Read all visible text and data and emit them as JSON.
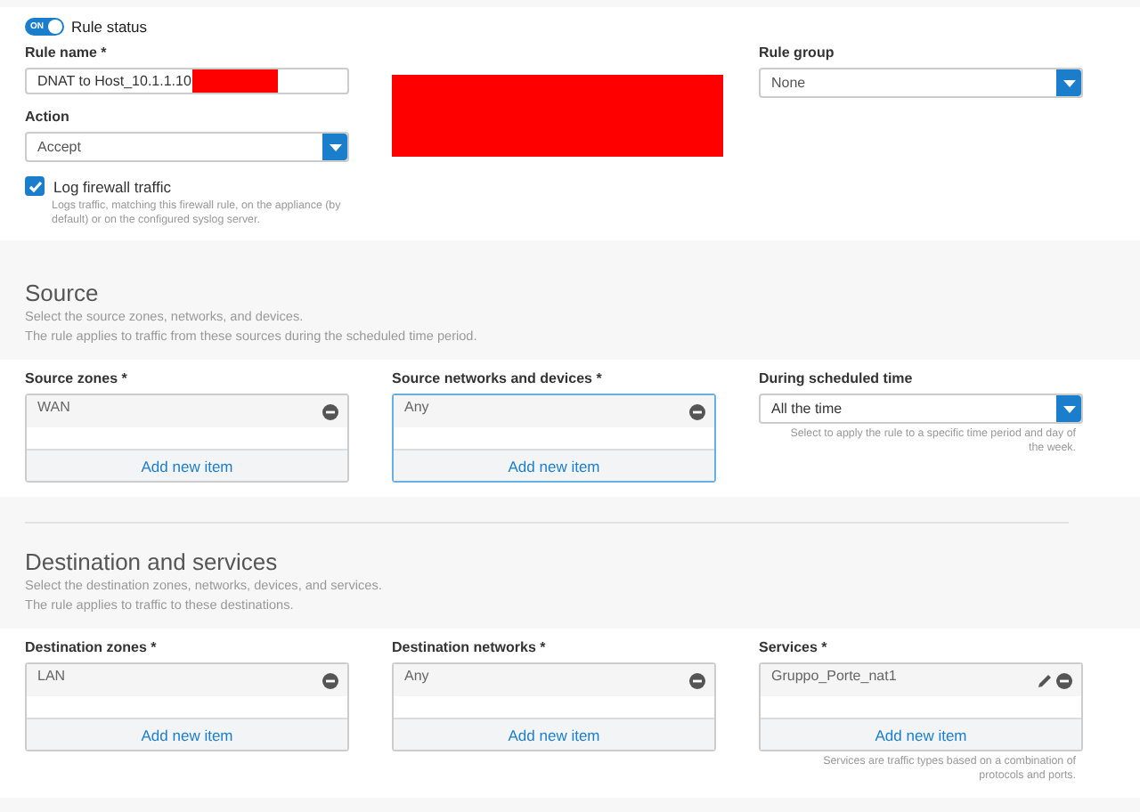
{
  "rule_status": {
    "label": "Rule status",
    "toggle_text": "ON",
    "on": true
  },
  "rule_name": {
    "label": "Rule name *",
    "value": "DNAT to Host_10.1.1.10",
    "redacted": true
  },
  "description": {
    "redacted": true
  },
  "rule_group": {
    "label": "Rule group",
    "value": "None"
  },
  "action": {
    "label": "Action",
    "value": "Accept"
  },
  "log_traffic": {
    "label": "Log firewall traffic",
    "checked": true,
    "help": "Logs traffic, matching this firewall rule, on the appliance (by default) or on the configured syslog server."
  },
  "sections": [
    {
      "title": "Source",
      "description": [
        "Select the source zones, networks, and devices.",
        "The rule applies to traffic from these sources during the scheduled time period."
      ],
      "fields": [
        {
          "kind": "list",
          "label": "Source zones *",
          "focused": false,
          "items": [
            {
              "text": "WAN",
              "editable": false
            }
          ],
          "add": "Add new item"
        },
        {
          "kind": "list",
          "label": "Source networks and devices *",
          "focused": true,
          "items": [
            {
              "text": "Any",
              "editable": false
            }
          ],
          "add": "Add new item"
        },
        {
          "kind": "select",
          "label": "During scheduled time",
          "value": "All the time",
          "help": "Select to apply the rule to a specific time period and day of the week."
        }
      ]
    },
    {
      "title": "Destination and services",
      "description": [
        "Select the destination zones, networks, devices, and services.",
        "The rule applies to traffic to these destinations."
      ],
      "fields": [
        {
          "kind": "list",
          "label": "Destination zones *",
          "focused": false,
          "items": [
            {
              "text": "LAN",
              "editable": false
            }
          ],
          "add": "Add new item"
        },
        {
          "kind": "list",
          "label": "Destination networks *",
          "focused": false,
          "items": [
            {
              "text": "Any",
              "editable": false
            }
          ],
          "add": "Add new item"
        },
        {
          "kind": "list",
          "label": "Services *",
          "focused": false,
          "items": [
            {
              "text": "Gruppo_Porte_nat1",
              "editable": true
            }
          ],
          "add": "Add new item",
          "help": "Services are traffic types based on a combination of protocols and ports."
        }
      ]
    }
  ]
}
